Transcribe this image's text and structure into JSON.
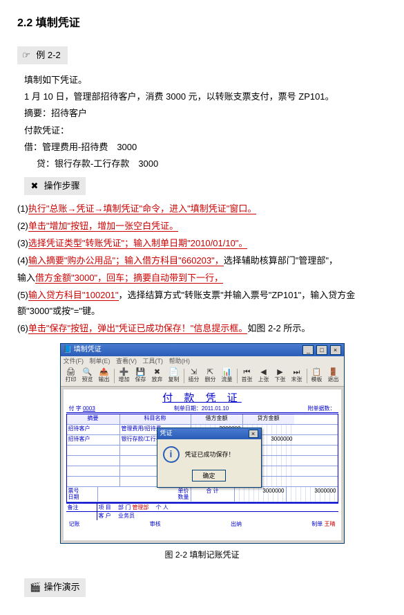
{
  "heading": "2.2 填制凭证",
  "example_label": "例 2-2",
  "intro": "填制如下凭证。",
  "scenario": "1 月 10 日，管理部招待客户，消费 3000 元，以转账支票支付，票号 ZP101。",
  "summary_line": "摘要：招待客户",
  "voucher_type_line": "付款凭证：",
  "debit_line": "借：管理费用-招待费　3000",
  "credit_line": "贷：银行存款-工行存款　3000",
  "steps_heading": "操作步骤",
  "steps": {
    "s1_red": "执行\"总账→凭证→填制凭证\"命令，进入\"填制凭证\"窗口。",
    "s2_red": "单击\"增加\"按钮，增加一张空白凭证。",
    "s3_red_a": "选择凭证类型\"转账凭证\"；输入制单日期\"20",
    "s3_red_b": "10/01/10\"。",
    "s4_a": "输入摘要\"购办公用品\"；输入借方",
    "s4_b": "科目\"660203\"，",
    "s4_c": "选择辅助核算部门\"管理部\"，",
    "s4_d": "借方金额\"3000\"，",
    "s4_e": "回车；摘要自动带到下一行，",
    "s5_a": "输入贷方",
    "s5_b": "科目\"100201\"",
    "s5_c": "，选择结算方式\"转账支票\"并输入票号\"ZP101\"，输入贷方金额\"3000\"或按\"=\"键。",
    "s6_red": "单击\"保存\"按钮，弹出\"凭证已成功保存！\"信息提示框。",
    "s6_tail": "如图 2-2 所示。"
  },
  "shot": {
    "title": "填制凭证",
    "menu": [
      "文件(F)",
      "制单(E)",
      "查看(V)",
      "工具(T)",
      "帮助(H)"
    ],
    "toolbar": [
      "打印",
      "预览",
      "输出",
      "增加",
      "保存",
      "放弃",
      "复制",
      "插分",
      "删分",
      "流量",
      "首张",
      "上张",
      "下张",
      "末张",
      "模板",
      "退出"
    ],
    "voucher_title": "付 款 凭 证",
    "left_label": "付 字",
    "left_no": "0003",
    "date_label": "制单日期：2011.01.10",
    "attach_label": "附单据数：",
    "headers": {
      "summary": "摘要",
      "subject": "科目名称",
      "debit": "借方金额",
      "credit": "贷方金额"
    },
    "rows": [
      {
        "summary": "招待客户",
        "subject": "管理费用/招待费",
        "debit": "3000000",
        "credit": ""
      },
      {
        "summary": "招待客户",
        "subject": "银行存款/工行存款",
        "debit": "",
        "credit": "3000000"
      }
    ],
    "foot": {
      "pn_label": "票号",
      "date_label": "日期",
      "unit_label": "单价",
      "qty_label": "数量",
      "total_label": "合 计",
      "total_debit": "3000000",
      "total_credit": "3000000",
      "remark_label": "备注",
      "proj_label": "项 目",
      "dept_label": "部 门",
      "dept_val": "管理部",
      "cust_label": "客 户",
      "person_label": "个 人",
      "vendor_label": "业务员",
      "recorder": "记账",
      "audit": "审核",
      "cashier": "出纳",
      "maker_label": "制单",
      "maker": "王晴"
    },
    "msg": {
      "title": "凭证",
      "text": "凭证已成功保存！",
      "ok": "确定"
    }
  },
  "caption": "图 2-2 填制记账凭证",
  "demo_heading": "操作演示"
}
